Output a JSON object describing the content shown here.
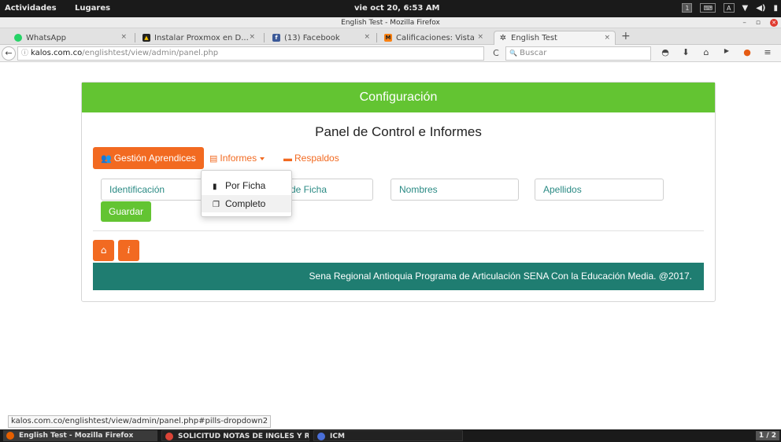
{
  "topbar": {
    "activities": "Actividades",
    "places": "Lugares",
    "clock": "vie oct 20,  6:53 AM",
    "workspace_1": "1"
  },
  "window": {
    "title": "English Test - Mozilla Firefox",
    "minimize": "–",
    "restore": "▫",
    "close": "✕"
  },
  "tabs": [
    {
      "label": "WhatsApp",
      "icon": "whatsapp-icon"
    },
    {
      "label": "Instalar Proxmox en D...",
      "icon": "tux-icon"
    },
    {
      "label": "(13) Facebook",
      "icon": "facebook-icon"
    },
    {
      "label": "Calificaciones: Vista",
      "icon": "moodle-icon"
    },
    {
      "label": "English Test",
      "icon": "sena-icon"
    }
  ],
  "tab_close": "×",
  "new_tab": "+",
  "navbar": {
    "back": "←",
    "info": "ⓘ",
    "url_domain": "kalos.com.co",
    "url_path": "/englishtest/view/admin/panel.php",
    "reload": "C",
    "search_placeholder": "Buscar",
    "search_icon": "🔍"
  },
  "page": {
    "header": "Configuración",
    "title": "Panel de Control e Informes",
    "pills": {
      "gestion": "Gestión Aprendices",
      "informes": "Informes",
      "respaldos": "Respaldos"
    },
    "fields": {
      "identificacion": "Identificación",
      "ficha": "de Ficha",
      "nombres": "Nombres",
      "apellidos": "Apellidos"
    },
    "save_label": "Guardar",
    "home_icon": "⌂",
    "info_icon": "i",
    "footer": "Sena Regional Antioquia Programa de Articulación SENA Con la Educación Media. @2017.",
    "dropdown": {
      "por_ficha": "Por Ficha",
      "completo": "Completo"
    }
  },
  "status_url": "kalos.com.co/englishtest/view/admin/panel.php#pills-dropdown2",
  "taskbar": {
    "firefox": "English Test - Mozilla Firefox",
    "chrome": "SOLICITUD NOTAS DE INGLES Y R...",
    "icm": "ICM",
    "pager": "1 / 2"
  },
  "colors": {
    "accent_green": "#63c432",
    "accent_orange": "#f26a21",
    "footer_teal": "#1f7d71"
  }
}
